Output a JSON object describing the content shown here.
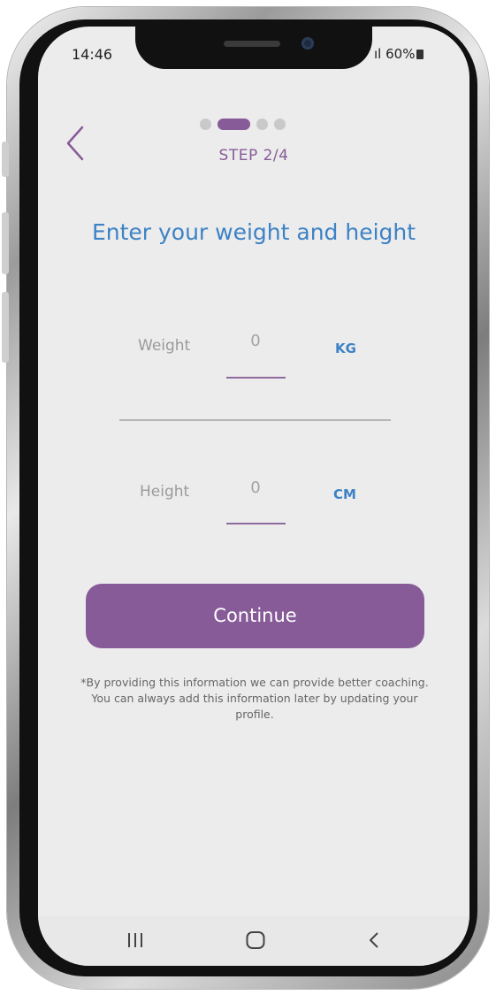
{
  "status_bar": {
    "time": "14:46",
    "signal": "ıl",
    "battery": "60%"
  },
  "progress": {
    "current_step": 2,
    "total_steps": 4,
    "label": "STEP 2/4"
  },
  "title": "Enter your weight and height",
  "weight": {
    "label": "Weight",
    "value": "0",
    "unit": "KG"
  },
  "height": {
    "label": "Height",
    "value": "0",
    "unit": "CM"
  },
  "continue_label": "Continue",
  "disclaimer": "*By providing this information we can provide better coaching. You can always add this information later by updating your profile.",
  "colors": {
    "accent": "#875b98",
    "title_blue": "#3d82c5",
    "background": "#ececec"
  },
  "icons": {
    "back": "chevron-left-icon",
    "nav_recents": "recents-icon",
    "nav_home": "home-icon",
    "nav_back": "back-icon"
  }
}
